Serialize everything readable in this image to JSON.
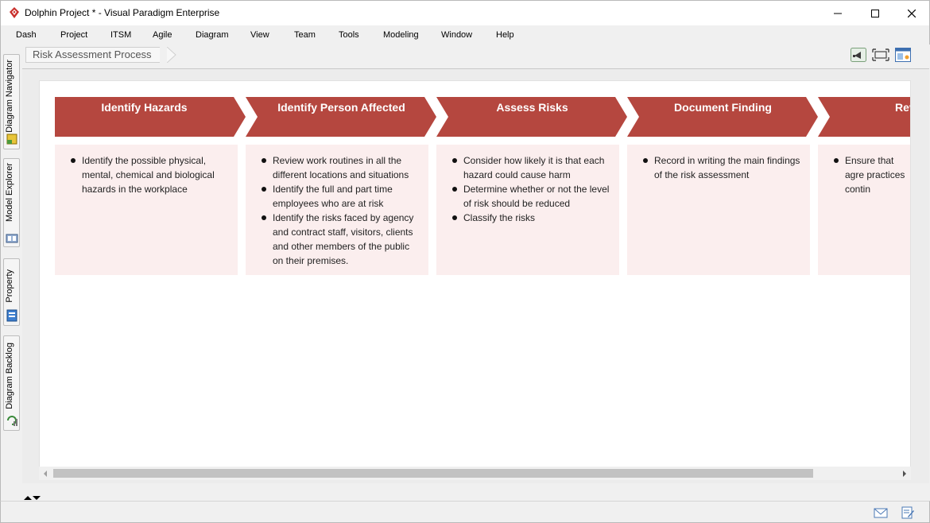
{
  "window": {
    "title": "Dolphin Project * - Visual Paradigm Enterprise"
  },
  "menu": [
    {
      "label": "Dash",
      "name": "menu-dash"
    },
    {
      "label": "Project",
      "name": "menu-project"
    },
    {
      "label": "ITSM",
      "name": "menu-itsm"
    },
    {
      "label": "Agile",
      "name": "menu-agile"
    },
    {
      "label": "Diagram",
      "name": "menu-diagram"
    },
    {
      "label": "View",
      "name": "menu-view"
    },
    {
      "label": "Team",
      "name": "menu-team"
    },
    {
      "label": "Tools",
      "name": "menu-tools"
    },
    {
      "label": "Modeling",
      "name": "menu-modeling"
    },
    {
      "label": "Window",
      "name": "menu-window"
    },
    {
      "label": "Help",
      "name": "menu-help"
    }
  ],
  "side_tabs": [
    {
      "label": "Diagram Navigator",
      "icon": "diagram-navigator-icon"
    },
    {
      "label": "Model Explorer",
      "icon": "model-explorer-icon"
    },
    {
      "label": "Property",
      "icon": "property-icon"
    },
    {
      "label": "Diagram Backlog",
      "icon": "diagram-backlog-icon"
    }
  ],
  "breadcrumb": {
    "label": "Risk Assessment Process"
  },
  "toolbar_icons": [
    "announcement-icon",
    "fit-diagram-icon",
    "layout-panel-icon"
  ],
  "colors": {
    "step_header": "#b5473f",
    "step_body": "#fbeeee",
    "canvas": "#ffffff"
  },
  "steps": [
    {
      "title": "Identify Hazards",
      "bullets": [
        "Identify the possible physical, mental, chemical and biological hazards in the workplace"
      ]
    },
    {
      "title": "Identify Person Affected",
      "bullets": [
        "Review work routines in all the different locations and situations",
        "Identify the full and part time employees who are at risk",
        "Identify the risks faced by agency and contract staff, visitors, clients and other members of the public on their premises."
      ]
    },
    {
      "title": "Assess Risks",
      "bullets": [
        "Consider how likely it is that each hazard could cause harm",
        "Determine whether or not the level of risk should be reduced",
        "Classify the risks"
      ]
    },
    {
      "title": "Document Finding",
      "bullets": [
        "Record in writing the main findings of the risk assessment"
      ]
    },
    {
      "title": "Rev",
      "bullets": [
        "Ensure that agre practices contin"
      ]
    }
  ],
  "status_icons": [
    "mail-icon",
    "edit-note-icon"
  ]
}
